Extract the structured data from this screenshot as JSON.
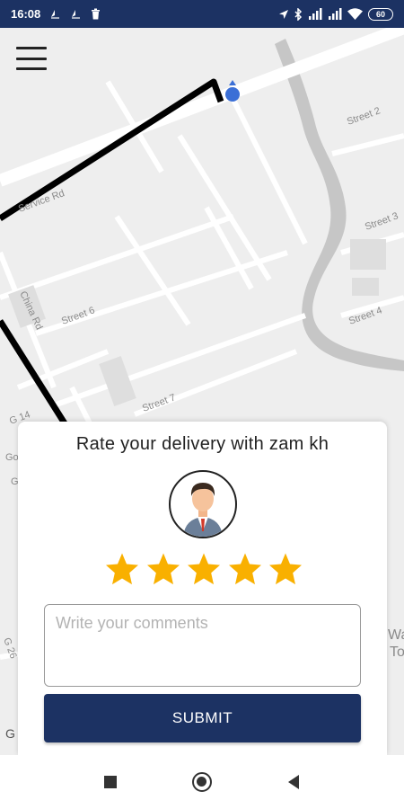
{
  "status_bar": {
    "time": "16:08",
    "battery": "60",
    "left_icons": [
      "navigation-arrow-icon",
      "navigation-arrow-icon",
      "trash-icon"
    ],
    "right_icons": [
      "location-icon",
      "bluetooth-icon",
      "signal-icon",
      "signal-icon",
      "wifi-icon",
      "battery-icon"
    ]
  },
  "map": {
    "street_labels": [
      "Street 2",
      "Street 3",
      "Street 4",
      "Street 6",
      "Street 7",
      "China Rd",
      "Service Rd",
      "G 14",
      "G 26",
      "Go",
      "G",
      "Wa",
      "To",
      "G"
    ],
    "colors": {
      "background": "#eeeeee",
      "road": "#ffffff",
      "river": "#c4c4c4",
      "route": "#000000",
      "location_dot": "#3b6fd6"
    }
  },
  "menu": {
    "icon": "hamburger-menu-icon"
  },
  "rating": {
    "title": "Rate your delivery with zam kh",
    "stars": 5,
    "star_color": "#f9b000",
    "comments_placeholder": "Write your comments",
    "comments_value": "",
    "submit_label": "SUBMIT",
    "submit_color": "#1c3263"
  },
  "nav_bar": {
    "buttons": [
      "recent-apps-icon",
      "home-icon",
      "back-icon"
    ]
  }
}
